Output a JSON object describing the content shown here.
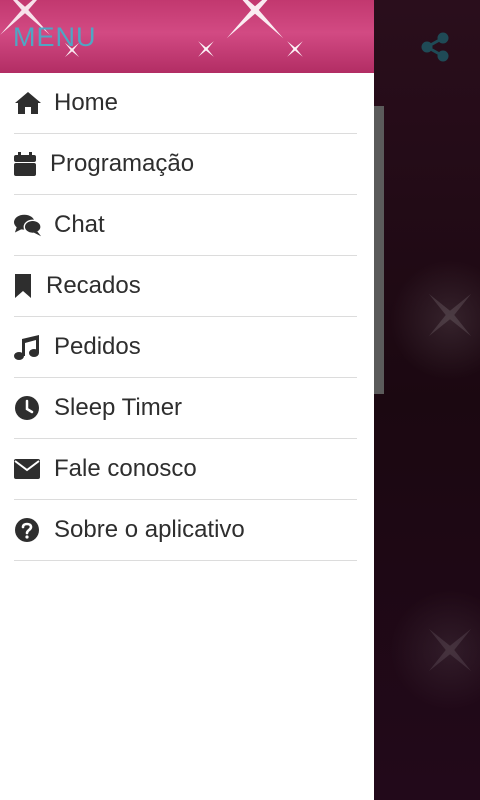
{
  "drawer": {
    "title": "MENU",
    "items": [
      {
        "label": "Home",
        "icon": "home-icon"
      },
      {
        "label": "Programação",
        "icon": "calendar-icon"
      },
      {
        "label": "Chat",
        "icon": "chat-icon"
      },
      {
        "label": "Recados",
        "icon": "bookmark-icon"
      },
      {
        "label": "Pedidos",
        "icon": "music-icon"
      },
      {
        "label": "Sleep Timer",
        "icon": "clock-icon"
      },
      {
        "label": "Fale conosco",
        "icon": "envelope-icon"
      },
      {
        "label": "Sobre o aplicativo",
        "icon": "question-circle-icon"
      }
    ]
  },
  "toolbar": {
    "share_icon": "share-icon"
  },
  "colors": {
    "header_pink": "#c2386f",
    "title_blue": "#4fa6c4",
    "text": "#2e2e2e",
    "divider": "#dcdcdc",
    "background": "#1b0811"
  }
}
